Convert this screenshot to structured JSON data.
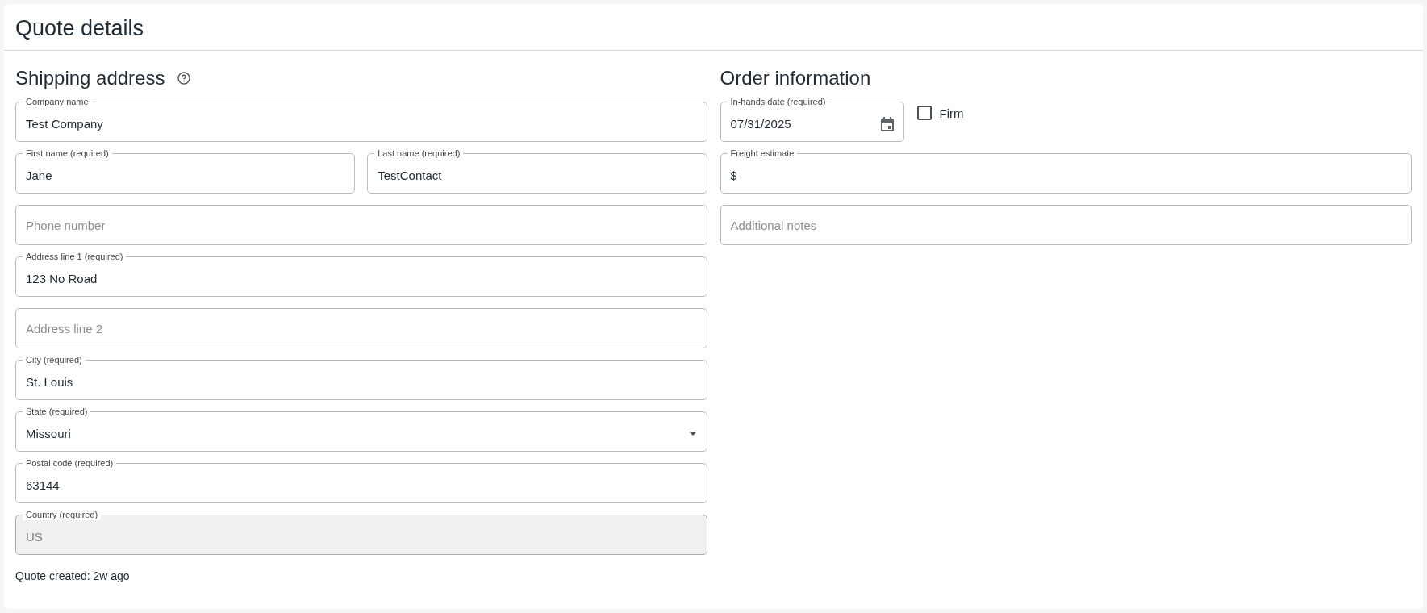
{
  "title": "Quote details",
  "shipping": {
    "heading": "Shipping address",
    "rows": [
      [
        {
          "kind": "text",
          "label": "Company name",
          "value": "Test Company",
          "disabled": false
        }
      ],
      [
        {
          "kind": "text",
          "label": "First name (required)",
          "value": "Jane",
          "disabled": false
        },
        {
          "kind": "text",
          "label": "Last name (required)",
          "value": "TestContact",
          "disabled": false
        }
      ],
      [
        {
          "kind": "text",
          "placeholder": "Phone number",
          "disabled": false
        }
      ],
      [
        {
          "kind": "text",
          "label": "Address line 1 (required)",
          "value": "123 No Road",
          "disabled": false
        }
      ],
      [
        {
          "kind": "text",
          "placeholder": "Address line 2",
          "disabled": false
        }
      ],
      [
        {
          "kind": "text",
          "label": "City (required)",
          "value": "St. Louis",
          "disabled": false
        }
      ],
      [
        {
          "kind": "select",
          "label": "State (required)",
          "value": "Missouri",
          "disabled": false
        }
      ],
      [
        {
          "kind": "text",
          "label": "Postal code (required)",
          "value": "63144",
          "disabled": false
        }
      ],
      [
        {
          "kind": "text",
          "label": "Country (required)",
          "value": "US",
          "disabled": true
        }
      ]
    ]
  },
  "order": {
    "heading": "Order information",
    "date": {
      "kind": "date",
      "label": "In-hands date (required)",
      "value": "07/31/2025",
      "disabled": false
    },
    "firm": {
      "label": "Firm",
      "checked": false
    },
    "rows": [
      [
        {
          "kind": "text",
          "label": "Freight estimate",
          "prefix": "$",
          "disabled": false
        }
      ],
      [
        {
          "kind": "text",
          "placeholder": "Additional notes",
          "disabled": false
        }
      ]
    ]
  },
  "footer": "Quote created: 2w ago"
}
